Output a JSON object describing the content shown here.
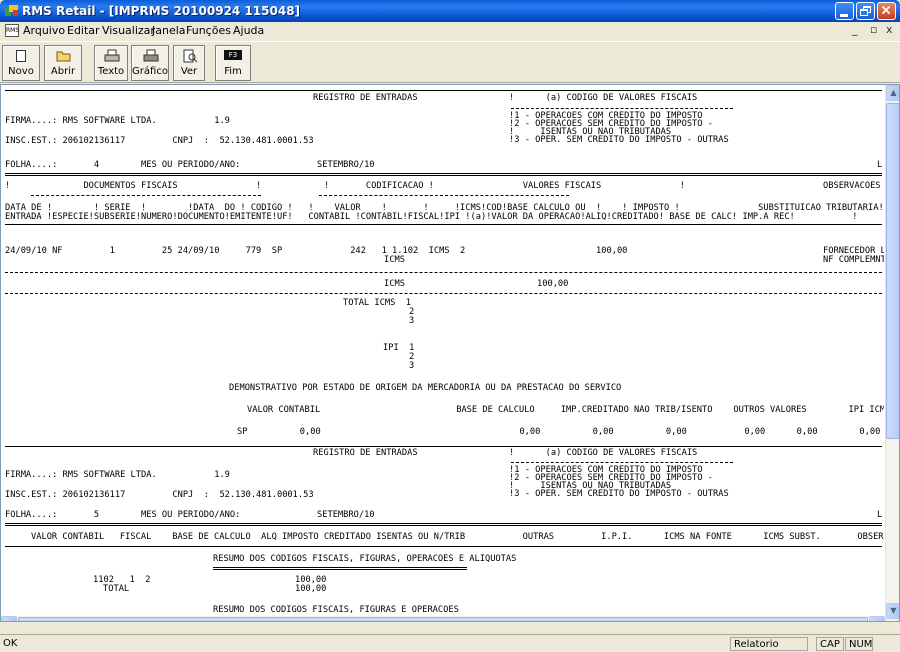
{
  "window": {
    "title": "RMS Retail - [IMPRMS 20100924 115048]"
  },
  "menu": [
    "Arquivo",
    "Editar",
    "Visualizar",
    "Janela",
    "Funções",
    "Ajuda"
  ],
  "mdi_icon_label": "RMS",
  "toolbar": [
    {
      "label": "Novo",
      "icon": "new-doc-icon"
    },
    {
      "label": "Abrir",
      "icon": "open-folder-icon"
    },
    {
      "label": "Texto",
      "icon": "printer-text-icon"
    },
    {
      "label": "Gráfico",
      "icon": "printer-graphic-icon"
    },
    {
      "label": "Ver",
      "icon": "preview-icon"
    },
    {
      "label": "Fim",
      "key": "F3"
    }
  ],
  "report": {
    "lines": [
      {
        "t": "REGISTRO DE ENTRADAS",
        "x": 0
      },
      {
        "t": "!      (a) CODIGO DE VALORES FISCAIS",
        "x": 0
      },
      {
        "t": "FIRMA....: RMS SOFTWARE LTDA.           1.9",
        "x": 0
      },
      {
        "t": "!1 - OPERACOES COM CREDITO DO IMPOSTO",
        "x": 0
      },
      {
        "t": "!2 - OPERACOES SEM CREDITO DO IMPOSTO -",
        "x": 0
      },
      {
        "t": "INSC.EST.: 206102136117         CNPJ  :  52.130.481.0001.53",
        "x": 0
      },
      {
        "t": "!     ISENTAS OU NAO TRIBUTADAS",
        "x": 0
      },
      {
        "t": "!3 - OPER. SEM CREDITO DO IMPOSTO - OUTRAS",
        "x": 0
      },
      {
        "t": "FOLHA....:       4        MES OU PERIODO/ANO:",
        "x": 0
      },
      {
        "t": "SETEMBRO/10",
        "x": 0
      },
      {
        "t": "L",
        "x": 0
      },
      {
        "t": "!              DOCUMENTOS FISCAIS               !            !       CODIFICACAO !                 VALORES FISCAIS               !",
        "x": 0
      },
      {
        "t": "OBSERVACOES",
        "x": 0
      },
      {
        "t": "DATA DE !        ! SERIE  !        !DATA  DO ! CODIGO !   !    VALOR    !       !     !ICMS!COD!BASE CALCULO OU  !    ! IMPOSTO !               SUBSTITUICAO TRIBUTARIA!!ICMS FONTE!       SUBSTITUTO",
        "x": 0
      },
      {
        "t": "ENTRADA !ESPECIE!SUBSERIE!NUMERO!DOCUMENTO!EMITENTE!UF!   CONTABIL !CONTABIL!FISCAL!IPI !(a)!VALOR DA OPERACAO!ALIQ!CREDITADO! BASE DE CALC! IMP.A REC!           !      ! B.CALCULO ! IMP RET",
        "x": 0
      },
      {
        "t": "24/09/10 NF         1         25 24/09/10     779  SP             242   1 1.102  ICMS  2                         100,00",
        "x": 0
      },
      {
        "t": "ICMS",
        "x": 0
      },
      {
        "t": "FORNECEDOR LTDA",
        "x": 0
      },
      {
        "t": "NF COMPLEMNTAR ICMS",
        "x": 0
      },
      {
        "t": "ICMS",
        "x": 0
      },
      {
        "t": "100,00",
        "x": 0
      },
      {
        "t": "TOTAL ICMS  1",
        "x": 0
      },
      {
        "t": "2",
        "x": 0
      },
      {
        "t": "3",
        "x": 0
      },
      {
        "t": "IPI  1",
        "x": 0
      },
      {
        "t": "2",
        "x": 0
      },
      {
        "t": "3",
        "x": 0
      },
      {
        "t": "DEMONSTRATIVO POR ESTADO DE ORIGEM DA MERCADORIA OU DA PRESTACAO DO SERVICO",
        "x": 0
      },
      {
        "t": "VALOR CONTABIL                          BASE DE CALCULO     IMP.CREDITADO NAO TRIB/ISENTO    OUTROS VALORES        IPI ICMS FONTE",
        "x": 0
      },
      {
        "t": "SP          0,00                                      0,00          0,00          0,00           0,00      0,00        0,00",
        "x": 0
      },
      {
        "t": "REGISTRO DE ENTRADAS",
        "x": 0
      },
      {
        "t": "!      (a) CODIGO DE VALORES FISCAIS",
        "x": 0
      },
      {
        "t": "FIRMA....: RMS SOFTWARE LTDA.           1.9",
        "x": 0
      },
      {
        "t": "!1 - OPERACOES COM CREDITO DO IMPOSTO",
        "x": 0
      },
      {
        "t": "!2 - OPERACOES SEM CREDITO DO IMPOSTO -",
        "x": 0
      },
      {
        "t": "INSC.EST.: 206102136117         CNPJ  :  52.130.481.0001.53",
        "x": 0
      },
      {
        "t": "!     ISENTAS OU NAO TRIBUTADAS",
        "x": 0
      },
      {
        "t": "!3 - OPER. SEM CREDITO DO IMPOSTO - OUTRAS",
        "x": 0
      },
      {
        "t": "FOLHA....:       5        MES OU PERIODO/ANO:",
        "x": 0
      },
      {
        "t": "SETEMBRO/10",
        "x": 0
      },
      {
        "t": "L",
        "x": 0
      },
      {
        "t": "VALOR CONTABIL   FISCAL    BASE DE CALCULO  ALQ IMPOSTO CREDITADO ISENTAS OU N/TRIB           OUTRAS         I.P.I.      ICMS NA FONTE      ICMS SUBST.       OBSERVACOES",
        "x": 0
      },
      {
        "t": "RESUMO DOS CODIGOS FISCAIS, FIGURAS, OPERACOES E ALIQUOTAS",
        "x": 0
      },
      {
        "t": "1102   1  2",
        "x": 0
      },
      {
        "t": "100,00",
        "x": 0
      },
      {
        "t": "TOTAL",
        "x": 0
      },
      {
        "t": "100,00",
        "x": 0
      },
      {
        "t": "RESUMO DOS CODIGOS FISCAIS, FIGURAS E OPERACOES",
        "x": 0
      }
    ]
  },
  "status": {
    "left": "OK",
    "mode": "Relatorio",
    "cap": "CAP",
    "num": "NUM"
  }
}
